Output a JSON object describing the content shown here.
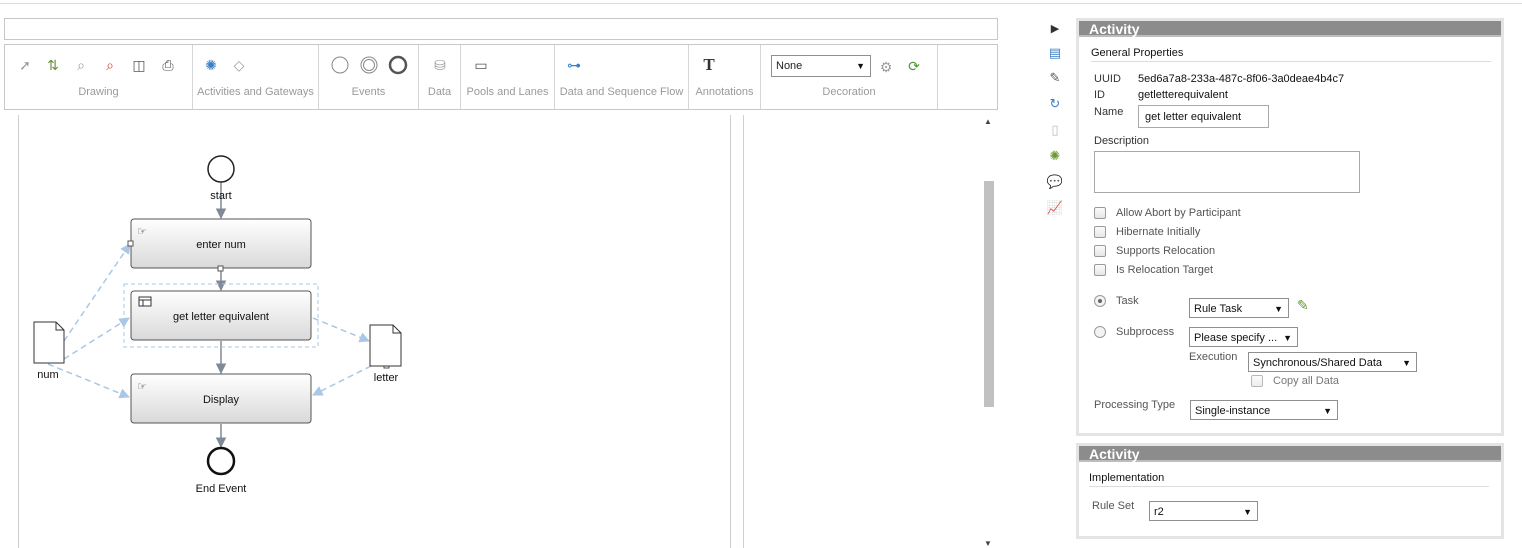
{
  "toolbar": {
    "groups": {
      "drawing": "Drawing",
      "activities": "Activities and Gateways",
      "events": "Events",
      "data": "Data",
      "pools": "Pools and Lanes",
      "flow": "Data and Sequence Flow",
      "annotations": "Annotations",
      "decoration": "Decoration"
    },
    "decoration_value": "None"
  },
  "diagram": {
    "start": "start",
    "end": "End Event",
    "task1": "enter num",
    "task2": "get letter equivalent",
    "task3": "Display",
    "data_in": "num",
    "data_out": "letter"
  },
  "panel1": {
    "title": "Activity",
    "section": "General Properties",
    "uuid_label": "UUID",
    "uuid_value": "5ed6a7a8-233a-487c-8f06-3a0deae4b4c7",
    "id_label": "ID",
    "id_value": "getletterequivalent",
    "name_label": "Name",
    "name_value": "get letter equivalent",
    "description_label": "Description",
    "description_value": "",
    "checkboxes": [
      "Allow Abort by Participant",
      "Hibernate Initially",
      "Supports Relocation",
      "Is Relocation Target"
    ],
    "task_label": "Task",
    "task_value": "Rule Task",
    "subprocess_label": "Subprocess",
    "subprocess_value": "Please specify ...",
    "execution_label": "Execution",
    "execution_value": "Synchronous/Shared Data",
    "copy_label": "Copy all Data",
    "processing_label": "Processing Type",
    "processing_value": "Single-instance"
  },
  "panel2": {
    "title": "Activity",
    "section": "Implementation",
    "ruleset_label": "Rule Set",
    "ruleset_value": "r2"
  },
  "colors": {
    "panel_header": "#8c8c8c",
    "flow_arrow": "#7f8a96",
    "data_assoc": "#a9c7e6"
  }
}
